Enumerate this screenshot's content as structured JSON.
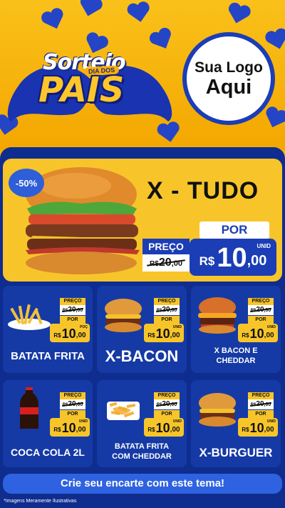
{
  "header": {
    "sorteio": "Sorteio",
    "dia_dos": "DIA DOS",
    "pais": "PAIS",
    "logo_line1": "Sua Logo",
    "logo_line2": "Aqui"
  },
  "hero": {
    "discount": "-50%",
    "title": "X - TUDO",
    "preco_label": "PREÇO",
    "old_currency": "R$",
    "old_int": "20",
    "old_dec": ",00",
    "por_label": "POR",
    "currency": "R$",
    "price_int": "10",
    "price_dec": ",00",
    "unit": "UNID"
  },
  "products": [
    {
      "name": "BATATA FRITA",
      "preco_label": "PREÇO",
      "old_currency": "R$",
      "old_int": "20",
      "old_dec": ",00",
      "por_label": "POR",
      "currency": "R$",
      "price_int": "10",
      "price_dec": ",00",
      "unit": "POÇ",
      "icon": "fries"
    },
    {
      "name": "X-BACON",
      "preco_label": "PREÇO",
      "old_currency": "R$",
      "old_int": "20",
      "old_dec": ",00",
      "por_label": "POR",
      "currency": "R$",
      "price_int": "10",
      "price_dec": ",00",
      "unit": "UNID",
      "icon": "burger"
    },
    {
      "name": "X BACON E CHEDDAR",
      "preco_label": "PREÇO",
      "old_currency": "R$",
      "old_int": "20",
      "old_dec": ",00",
      "por_label": "POR",
      "currency": "R$",
      "price_int": "10",
      "price_dec": ",00",
      "unit": "UNID",
      "icon": "burger-cheddar"
    },
    {
      "name": "COCA COLA 2L",
      "preco_label": "PREÇO",
      "old_currency": "R$",
      "old_int": "20",
      "old_dec": ",00",
      "por_label": "POR",
      "currency": "R$",
      "price_int": "10",
      "price_dec": ",00",
      "unit": "UNID",
      "icon": "soda-bottle"
    },
    {
      "name": "BATATA FRITA COM CHEDDAR",
      "preco_label": "PREÇO",
      "old_currency": "R$",
      "old_int": "20",
      "old_dec": ",00",
      "por_label": "POR",
      "currency": "R$",
      "price_int": "10",
      "price_dec": ",00",
      "unit": "UNID",
      "icon": "fries-cheddar"
    },
    {
      "name": "X-BURGUER",
      "preco_label": "PREÇO",
      "old_currency": "R$",
      "old_int": "20",
      "old_dec": ",00",
      "por_label": "POR",
      "currency": "R$",
      "price_int": "10",
      "price_dec": ",00",
      "unit": "UNID",
      "icon": "burger"
    }
  ],
  "cta": "Crie seu encarte com este tema!",
  "footnote": "*Imagens Meramente Ilustrativas",
  "colors": {
    "yellow": "#f7c52a",
    "blue": "#1b3db5",
    "navy": "#0f2c8f"
  }
}
